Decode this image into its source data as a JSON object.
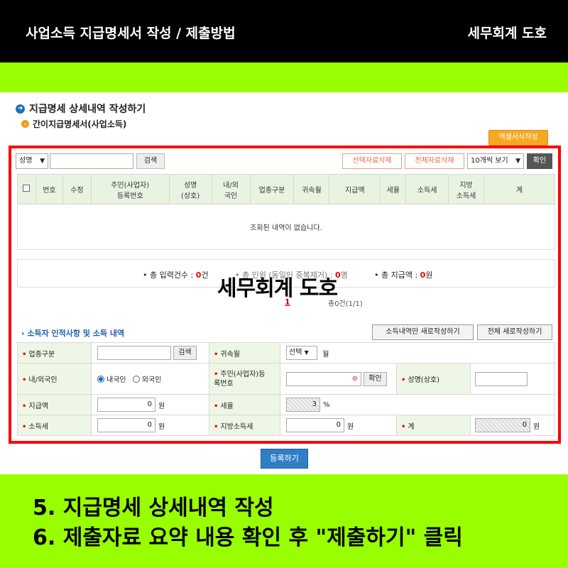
{
  "banner": {
    "title": "사업소득 지급명세서 작성 / 제출방법",
    "brand": "세무회계 도호"
  },
  "page": {
    "title": "지급명세 상세내역 작성하기",
    "subtitle": "간이지급명세서(사업소득)",
    "excel_button": "엑셀서식작성"
  },
  "search": {
    "field_select": "성명",
    "search_button": "검색",
    "delete_selected": "선택자료삭제",
    "delete_all": "전체자료삭제",
    "page_size": "10개씩 보기",
    "confirm": "확인"
  },
  "table": {
    "columns": [
      "번호",
      "수정",
      "주민(사업자)\n등록번호",
      "성명\n(상호)",
      "내/외\n국인",
      "업종구분",
      "귀속월",
      "지급액",
      "세율",
      "소득세",
      "지방\n소득세",
      "계"
    ],
    "empty_message": "조회된 내역이 없습니다."
  },
  "summary": {
    "count_label": "• 총 입력건수 :",
    "count_value": "0",
    "count_unit": "건",
    "people_label": "• 총 인원 (동일인 중복제거) :",
    "people_value": "0",
    "people_unit": "명",
    "amount_label": "• 총 지급액 :",
    "amount_value": "0",
    "amount_unit": "원"
  },
  "watermark": "세무회계 도호",
  "pager": {
    "current": "1",
    "info": "총0건(1/1)"
  },
  "form": {
    "section_title": "› 소득자 인적사항 및 소득 내역",
    "new_income_only": "소득내역만 새로작성하기",
    "new_all": "전체 새로작성하기",
    "industry_label": "업종구분",
    "search_button": "검색",
    "month_label": "귀속월",
    "month_select": "선택",
    "month_unit": "월",
    "nationality_label": "내/외국인",
    "domestic": "내국인",
    "foreign": "외국인",
    "id_label": "주민(사업자)등\n록번호",
    "id_confirm": "확인",
    "name_label": "성명(상호)",
    "pay_label": "지급액",
    "pay_value": "0",
    "won": "원",
    "rate_label": "세율",
    "rate_value": "3",
    "percent": "%",
    "tax_label": "소득세",
    "tax_value": "0",
    "local_tax_label": "지방소득세",
    "local_tax_value": "0",
    "total_label": "계",
    "total_value": "0"
  },
  "register_button": "등록하기",
  "instructions": {
    "line1": "5. 지급명세 상세내역 작성",
    "line2": "6. 제출자료 요약 내용 확인 후 \"제출하기\" 클릭"
  },
  "colors": {
    "accent_green": "#99ff00",
    "highlight_red": "#ff0000",
    "header_bg": "#e9f3e1"
  }
}
